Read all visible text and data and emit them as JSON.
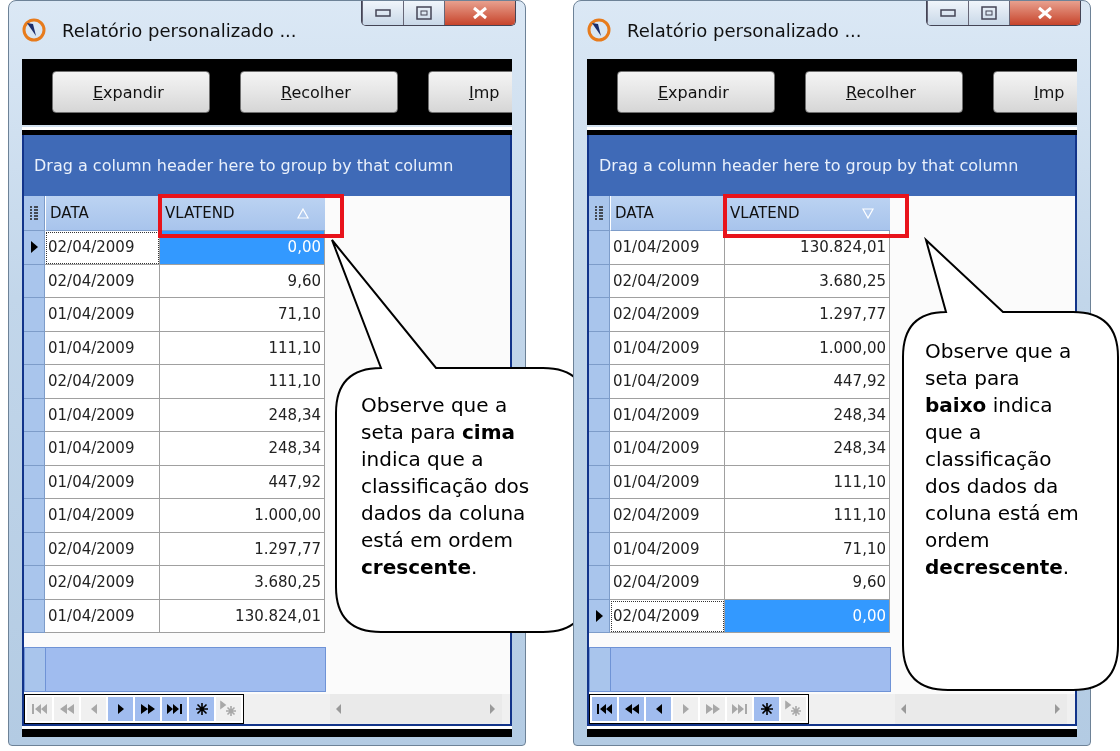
{
  "panels": [
    {
      "window": {
        "title": "Relatório personalizado ..."
      },
      "buttons": [
        "Expandir",
        "Recolher",
        "Imp"
      ],
      "group_panel": "Drag a column header here to group by that column",
      "columns": [
        {
          "label": "DATA",
          "sorted": false
        },
        {
          "label": "VLATEND",
          "sorted": true,
          "descending": false
        }
      ],
      "rows": [
        {
          "cells": [
            "02/04/2009",
            "0,00"
          ],
          "selected": true
        },
        {
          "cells": [
            "02/04/2009",
            "9,60"
          ],
          "selected": false
        },
        {
          "cells": [
            "01/04/2009",
            "71,10"
          ],
          "selected": false
        },
        {
          "cells": [
            "01/04/2009",
            "111,10"
          ],
          "selected": false
        },
        {
          "cells": [
            "02/04/2009",
            "111,10"
          ],
          "selected": false
        },
        {
          "cells": [
            "01/04/2009",
            "248,34"
          ],
          "selected": false
        },
        {
          "cells": [
            "01/04/2009",
            "248,34"
          ],
          "selected": false
        },
        {
          "cells": [
            "01/04/2009",
            "447,92"
          ],
          "selected": false
        },
        {
          "cells": [
            "01/04/2009",
            "1.000,00"
          ],
          "selected": false
        },
        {
          "cells": [
            "02/04/2009",
            "1.297,77"
          ],
          "selected": false
        },
        {
          "cells": [
            "02/04/2009",
            "3.680,25"
          ],
          "selected": false
        },
        {
          "cells": [
            "01/04/2009",
            "130.824,01"
          ],
          "selected": false
        }
      ],
      "navigator": [
        {
          "kind": "first",
          "disabled": true
        },
        {
          "kind": "prev-page",
          "disabled": true
        },
        {
          "kind": "prev",
          "disabled": true
        },
        {
          "kind": "next",
          "disabled": false
        },
        {
          "kind": "next-page",
          "disabled": false
        },
        {
          "kind": "last",
          "disabled": false
        },
        {
          "kind": "insert",
          "disabled": false
        },
        {
          "kind": "post",
          "disabled": true
        }
      ],
      "callout": "Observe que a seta para **cima** indica que a classificação dos dados da coluna está em ordem **crescente**."
    },
    {
      "window": {
        "title": "Relatório personalizado ..."
      },
      "buttons": [
        "Expandir",
        "Recolher",
        "Imp"
      ],
      "group_panel": "Drag a column header here to group by that column",
      "columns": [
        {
          "label": "DATA",
          "sorted": false
        },
        {
          "label": "VLATEND",
          "sorted": true,
          "descending": true
        }
      ],
      "rows": [
        {
          "cells": [
            "01/04/2009",
            "130.824,01"
          ],
          "selected": false
        },
        {
          "cells": [
            "02/04/2009",
            "3.680,25"
          ],
          "selected": false
        },
        {
          "cells": [
            "02/04/2009",
            "1.297,77"
          ],
          "selected": false
        },
        {
          "cells": [
            "01/04/2009",
            "1.000,00"
          ],
          "selected": false
        },
        {
          "cells": [
            "01/04/2009",
            "447,92"
          ],
          "selected": false
        },
        {
          "cells": [
            "01/04/2009",
            "248,34"
          ],
          "selected": false
        },
        {
          "cells": [
            "01/04/2009",
            "248,34"
          ],
          "selected": false
        },
        {
          "cells": [
            "01/04/2009",
            "111,10"
          ],
          "selected": false
        },
        {
          "cells": [
            "02/04/2009",
            "111,10"
          ],
          "selected": false
        },
        {
          "cells": [
            "01/04/2009",
            "71,10"
          ],
          "selected": false
        },
        {
          "cells": [
            "02/04/2009",
            "9,60"
          ],
          "selected": false
        },
        {
          "cells": [
            "02/04/2009",
            "0,00"
          ],
          "selected": true
        }
      ],
      "navigator": [
        {
          "kind": "first",
          "disabled": false
        },
        {
          "kind": "prev-page",
          "disabled": false
        },
        {
          "kind": "prev",
          "disabled": false
        },
        {
          "kind": "next",
          "disabled": true
        },
        {
          "kind": "next-page",
          "disabled": true
        },
        {
          "kind": "last",
          "disabled": true
        },
        {
          "kind": "insert",
          "disabled": false
        },
        {
          "kind": "post",
          "disabled": true
        }
      ],
      "callout": "Observe que a seta para **baixo** indica que a classificação dos dados da coluna está em ordem **decrescente**."
    }
  ]
}
